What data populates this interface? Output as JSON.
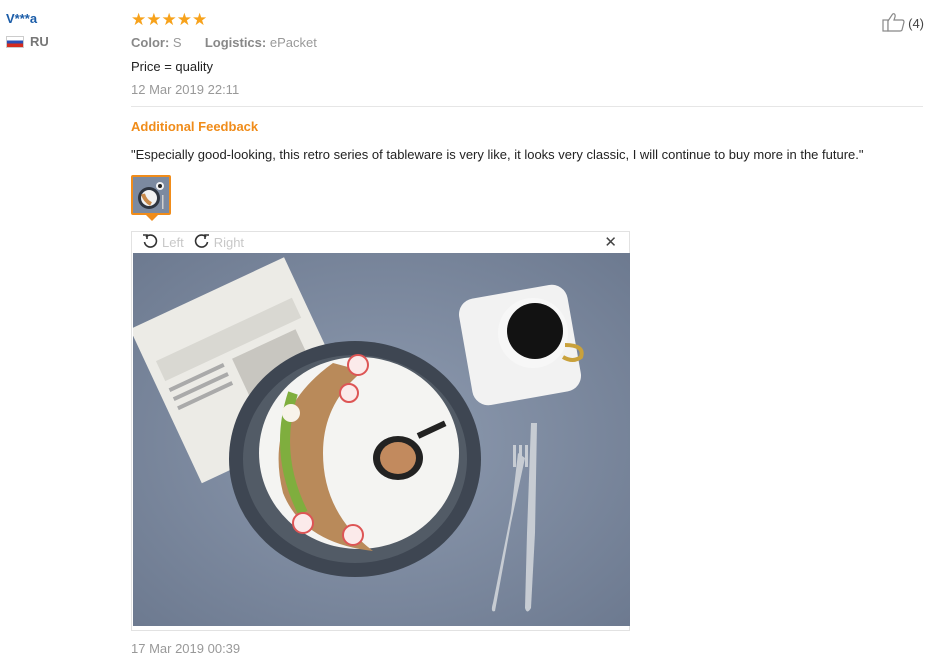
{
  "user": {
    "name": "V***a",
    "country": "RU"
  },
  "review": {
    "stars": "★★★★★",
    "color_label": "Color:",
    "color_value": "S",
    "logistics_label": "Logistics:",
    "logistics_value": "ePacket",
    "text": "Price = quality",
    "date": "12 Mar 2019 22:11"
  },
  "helpful": {
    "count": "(4)"
  },
  "additional": {
    "title": "Additional Feedback",
    "text": "\"Especially good-looking, this retro series of tableware is very like, it looks very classic, I will continue to buy more in the future.\"",
    "date": "17 Mar 2019 00:39"
  },
  "viewer": {
    "left_label": "Left",
    "right_label": "Right",
    "close": "✕"
  },
  "colors": {
    "accent": "#f08c1a",
    "link": "#1a5ca8",
    "muted": "#999999"
  }
}
